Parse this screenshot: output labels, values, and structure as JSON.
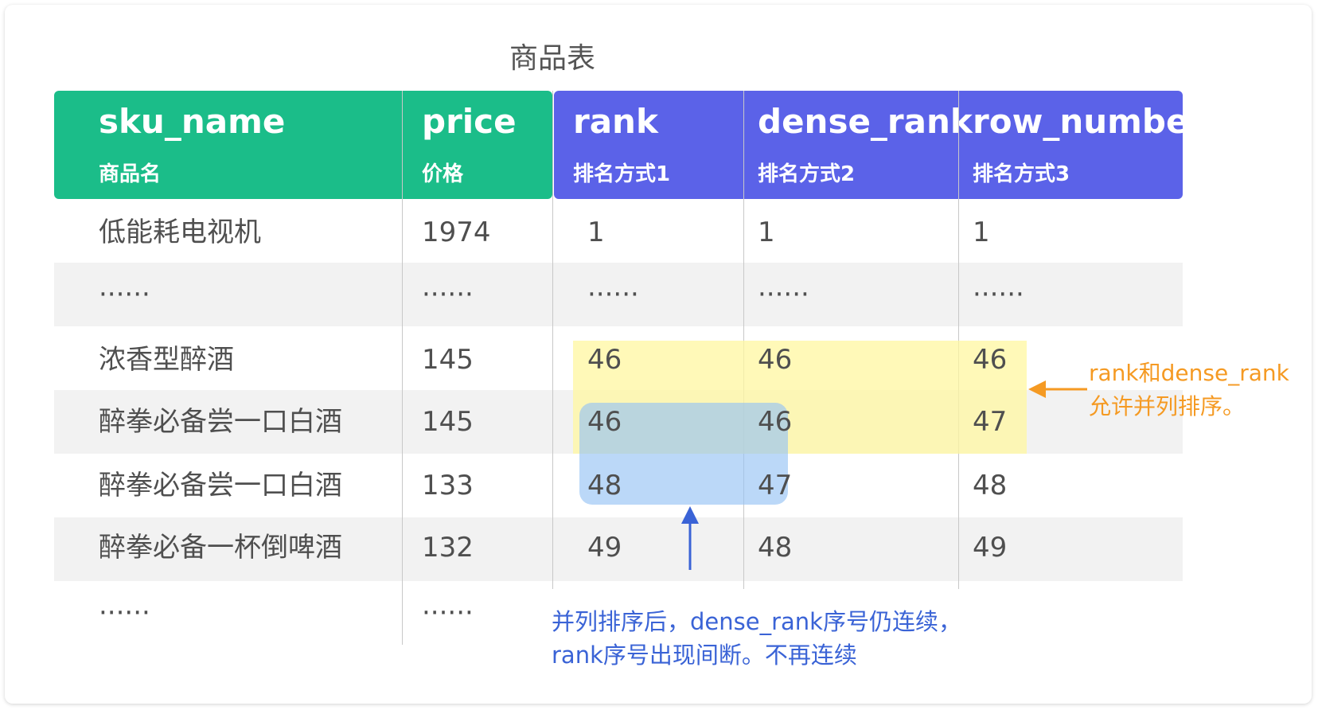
{
  "title": "商品表",
  "columns": [
    {
      "name": "sku_name",
      "sub": "商品名"
    },
    {
      "name": "price",
      "sub": "价格"
    },
    {
      "name": "rank",
      "sub": "排名方式1"
    },
    {
      "name": "dense_rank",
      "sub": "排名方式2"
    },
    {
      "name": "row_number",
      "sub": "排名方式3"
    }
  ],
  "rows": [
    {
      "sku_name": "低能耗电视机",
      "price": "1974",
      "rank": "1",
      "dense_rank": "1",
      "row_number": "1"
    },
    {
      "sku_name": "······",
      "price": "······",
      "rank": "······",
      "dense_rank": "······",
      "row_number": "······"
    },
    {
      "sku_name": "浓香型醉酒",
      "price": "145",
      "rank": "46",
      "dense_rank": "46",
      "row_number": "46"
    },
    {
      "sku_name": "醉拳必备尝一口白酒",
      "price": "145",
      "rank": "46",
      "dense_rank": "46",
      "row_number": "47"
    },
    {
      "sku_name": "醉拳必备尝一口白酒",
      "price": "133",
      "rank": "48",
      "dense_rank": "47",
      "row_number": "48"
    },
    {
      "sku_name": "醉拳必备一杯倒啤酒",
      "price": "132",
      "rank": "49",
      "dense_rank": "48",
      "row_number": "49"
    },
    {
      "sku_name": "······",
      "price": "······"
    }
  ],
  "annotations": {
    "orange_line1": "rank和dense_rank",
    "orange_line2": "允许并列排序。",
    "blue_line1": "并列排序后，dense_rank序号仍连续，",
    "blue_line2": "rank序号出现间断。不再连续"
  },
  "colors": {
    "header_green": "#1bbd89",
    "header_purple": "#5b62e8",
    "highlight_yellow": "#fff7a0",
    "highlight_blue": "#96c3f5",
    "orange_arrow": "#f59a23",
    "blue_arrow": "#3a63d6"
  }
}
